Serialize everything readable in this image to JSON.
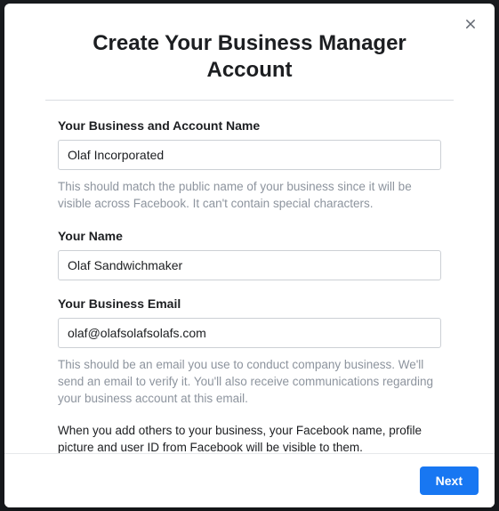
{
  "modal": {
    "title": "Create Your Business Manager Account",
    "close_label": "Close"
  },
  "fields": {
    "business_name": {
      "label": "Your Business and Account Name",
      "value": "Olaf Incorporated",
      "help": "This should match the public name of your business since it will be visible across Facebook. It can't contain special characters."
    },
    "your_name": {
      "label": "Your Name",
      "value": "Olaf Sandwichmaker"
    },
    "business_email": {
      "label": "Your Business Email",
      "value": "olaf@olafsolafsolafs.com",
      "help": "This should be an email you use to conduct company business. We'll send an email to verify it. You'll also receive communications regarding your business account at this email."
    }
  },
  "info_text": "When you add others to your business, your Facebook name, profile picture and user ID from Facebook will be visible to them.",
  "footer": {
    "next_label": "Next"
  }
}
